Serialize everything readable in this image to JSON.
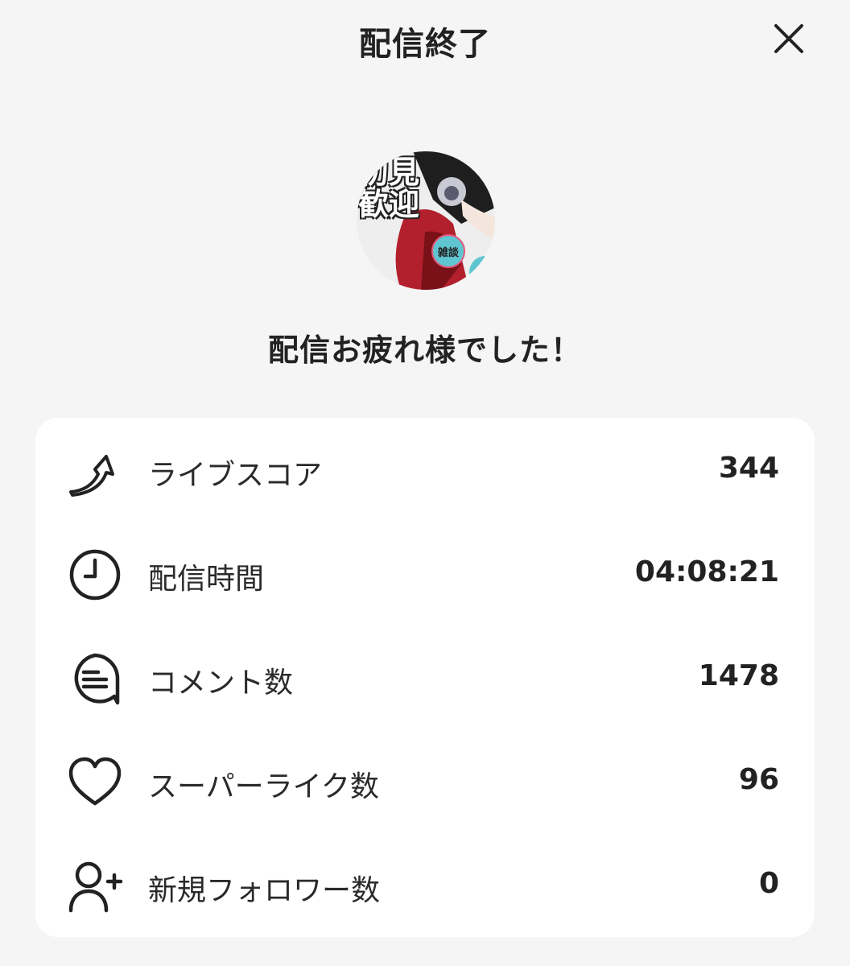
{
  "header": {
    "title": "配信終了",
    "close_icon": "close-icon"
  },
  "avatar": {
    "text": "初見歓迎",
    "badge": "雑談"
  },
  "message": "配信お疲れ様でした！",
  "stats": [
    {
      "icon": "live-score-arrow-icon",
      "label": "ライブスコア",
      "value": "344"
    },
    {
      "icon": "clock-icon",
      "label": "配信時間",
      "value": "04:08:21"
    },
    {
      "icon": "comment-icon",
      "label": "コメント数",
      "value": "1478"
    },
    {
      "icon": "heart-icon",
      "label": "スーパーライク数",
      "value": "96"
    },
    {
      "icon": "add-user-icon",
      "label": "新規フォロワー数",
      "value": "0"
    }
  ],
  "colors": {
    "background": "#f5f5f5",
    "card": "#ffffff",
    "text": "#222222",
    "badge": "#5fc6d1",
    "avatar_red": "#b3202d"
  }
}
